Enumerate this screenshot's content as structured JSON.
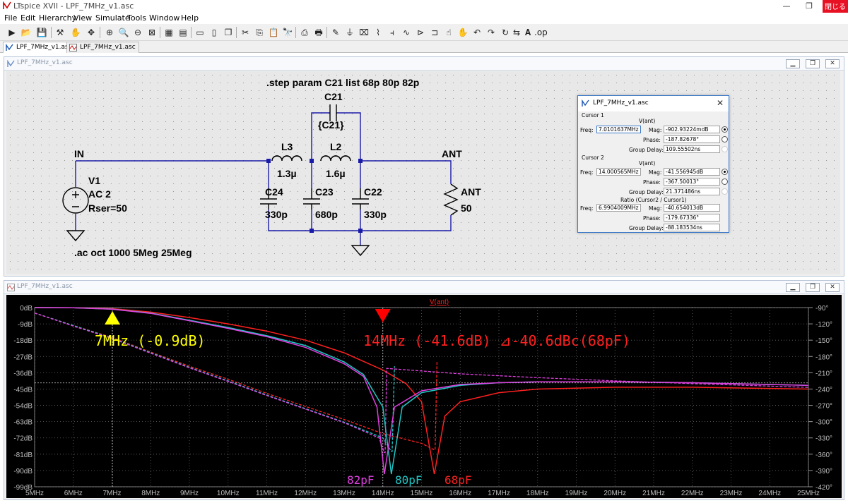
{
  "window": {
    "title": "LTspice XVII - LPF_7MHz_v1.asc",
    "close_label": "閉じる",
    "min_label": "—",
    "max_label": "❐"
  },
  "menu": [
    "File",
    "Edit",
    "Hierarchy",
    "View",
    "Simulate",
    "Tools",
    "Window",
    "Help"
  ],
  "tabs": [
    {
      "label": "LPF_7MHz_v1.asc",
      "active": true
    },
    {
      "label": "LPF_7MHz_v1.asc",
      "active": false
    }
  ],
  "schematic": {
    "window_title": "LPF_7MHz_v1.asc",
    "step_directive": ".step param C21 list 68p 80p 82p",
    "ac_directive": ".ac oct 1000 5Meg 25Meg",
    "net_in": "IN",
    "net_ant": "ANT",
    "v1": {
      "name": "V1",
      "value": "AC 2",
      "rser": "Rser=50"
    },
    "c21": {
      "name": "C21",
      "value": "{C21}"
    },
    "l3": {
      "name": "L3",
      "value": "1.3µ"
    },
    "l2": {
      "name": "L2",
      "value": "1.6µ"
    },
    "c24": {
      "name": "C24",
      "value": "330p"
    },
    "c23": {
      "name": "C23",
      "value": "680p"
    },
    "c22": {
      "name": "C22",
      "value": "330p"
    },
    "rant": {
      "name": "ANT",
      "value": "50"
    }
  },
  "cursor_dialog": {
    "title": "LPF_7MHz_v1.asc",
    "cursor1": {
      "header": "Cursor 1",
      "trace": "V(ant)",
      "freq_label": "Freq:",
      "freq": "7.0101637MHz",
      "mag_label": "Mag:",
      "mag": "-902.93224mdB",
      "phase_label": "Phase:",
      "phase": "-187.82678°",
      "gd_label": "Group Delay:",
      "gd": "109.55502ns"
    },
    "cursor2": {
      "header": "Cursor 2",
      "trace": "V(ant)",
      "freq_label": "Freq:",
      "freq": "14.000565MHz",
      "mag_label": "Mag:",
      "mag": "-41.556945dB",
      "phase_label": "Phase:",
      "phase": "-367.50013°",
      "gd_label": "Group Delay:",
      "gd": "21.371486ns"
    },
    "ratio": {
      "header": "Ratio (Cursor2 / Cursor1)",
      "freq_label": "Freq:",
      "freq": "6.9904009MHz",
      "mag_label": "Mag:",
      "mag": "-40.654013dB",
      "phase_label": "Phase:",
      "phase": "-179.67336°",
      "gd_label": "Group Delay:",
      "gd": "-88.183534ns"
    }
  },
  "waveform": {
    "window_title": "LPF_7MHz_v1.asc"
  },
  "chart_data": {
    "type": "line",
    "title": "V(ant)",
    "x_scale": "linear",
    "xlim": [
      5,
      25
    ],
    "x_ticks": [
      "5MHz",
      "6MHz",
      "7MHz",
      "8MHz",
      "9MHz",
      "10MHz",
      "11MHz",
      "12MHz",
      "13MHz",
      "14MHz",
      "15MHz",
      "16MHz",
      "17MHz",
      "18MHz",
      "19MHz",
      "20MHz",
      "21MHz",
      "22MHz",
      "23MHz",
      "24MHz",
      "25MHz"
    ],
    "y_left_ticks": [
      "0dB",
      "-9dB",
      "-18dB",
      "-27dB",
      "-36dB",
      "-45dB",
      "-54dB",
      "-63dB",
      "-72dB",
      "-81dB",
      "-90dB",
      "-99dB"
    ],
    "ylim_left": [
      -99,
      0
    ],
    "y_right_ticks": [
      "-90°",
      "-120°",
      "-150°",
      "-180°",
      "-210°",
      "-240°",
      "-270°",
      "-300°",
      "-330°",
      "-360°",
      "-390°",
      "-420°"
    ],
    "ylim_right": [
      -420,
      -90
    ],
    "grid": true,
    "cursor1": {
      "x": 7.01,
      "y": -0.9,
      "marker_color": "#ffff00"
    },
    "cursor2": {
      "x": 14.0,
      "y": -41.6,
      "marker_color": "#ff0000"
    },
    "annotations": [
      {
        "text": "7MHz (-0.9dB)",
        "color": "#ffff00"
      },
      {
        "text": "14MHz (-41.6dB) ⊿-40.6dBc(68pF)",
        "color": "#ff2020"
      },
      {
        "text": "82pF",
        "color": "#e040e0"
      },
      {
        "text": "80pF",
        "color": "#20c8c8"
      },
      {
        "text": "68pF",
        "color": "#ff2020"
      }
    ],
    "series": [
      {
        "name": "68pF",
        "color": "#ff2020",
        "notch": 15.33,
        "mag": [
          [
            5,
            0
          ],
          [
            6,
            -0.1
          ],
          [
            7,
            -0.6
          ],
          [
            8,
            -2.5
          ],
          [
            9,
            -5.5
          ],
          [
            10,
            -9
          ],
          [
            11,
            -13
          ],
          [
            12,
            -18
          ],
          [
            13,
            -25
          ],
          [
            14,
            -34.5
          ],
          [
            14.6,
            -42
          ],
          [
            15.0,
            -52
          ],
          [
            15.33,
            -92
          ],
          [
            15.6,
            -60
          ],
          [
            16,
            -52
          ],
          [
            17,
            -47
          ],
          [
            18,
            -45
          ],
          [
            20,
            -44
          ],
          [
            22,
            -44
          ],
          [
            25,
            -45
          ]
        ],
        "phase": [
          [
            5,
            -100
          ],
          [
            6,
            -123
          ],
          [
            7,
            -145
          ],
          [
            8,
            -172
          ],
          [
            9,
            -198
          ],
          [
            10,
            -222
          ],
          [
            11,
            -248
          ],
          [
            12,
            -272
          ],
          [
            13,
            -296
          ],
          [
            14,
            -322
          ],
          [
            15,
            -340
          ],
          [
            15.33,
            -352
          ],
          [
            15.35,
            -352
          ],
          [
            15.4,
            -190
          ]
        ]
      },
      {
        "name": "80pF",
        "color": "#20c8c8",
        "notch": 14.22,
        "mag": [
          [
            5,
            0
          ],
          [
            6,
            -0.1
          ],
          [
            7,
            -0.8
          ],
          [
            8,
            -3
          ],
          [
            9,
            -7
          ],
          [
            10,
            -11
          ],
          [
            11,
            -15.5
          ],
          [
            12,
            -21
          ],
          [
            13,
            -30
          ],
          [
            13.5,
            -37
          ],
          [
            14.0,
            -55
          ],
          [
            14.22,
            -92
          ],
          [
            14.5,
            -55
          ],
          [
            15,
            -47
          ],
          [
            16,
            -43
          ],
          [
            17,
            -41.5
          ],
          [
            18,
            -41
          ],
          [
            20,
            -41
          ],
          [
            22,
            -41.5
          ],
          [
            25,
            -43
          ]
        ],
        "phase": [
          [
            5,
            -100
          ],
          [
            6,
            -123
          ],
          [
            7,
            -146
          ],
          [
            8,
            -173
          ],
          [
            9,
            -200
          ],
          [
            10,
            -225
          ],
          [
            11,
            -251
          ],
          [
            12,
            -276
          ],
          [
            13,
            -301
          ],
          [
            14,
            -330
          ],
          [
            14.22,
            -355
          ],
          [
            14.24,
            -355
          ],
          [
            14.3,
            -198
          ]
        ]
      },
      {
        "name": "82pF",
        "color": "#e040e0",
        "notch": 14.04,
        "mag": [
          [
            5,
            0
          ],
          [
            6,
            -0.1
          ],
          [
            7,
            -0.9
          ],
          [
            8,
            -3.2
          ],
          [
            9,
            -7.3
          ],
          [
            10,
            -11.5
          ],
          [
            11,
            -16
          ],
          [
            12,
            -22
          ],
          [
            13,
            -31
          ],
          [
            13.5,
            -38
          ],
          [
            13.85,
            -55
          ],
          [
            14.04,
            -92
          ],
          [
            14.3,
            -55
          ],
          [
            15,
            -46
          ],
          [
            16,
            -42.5
          ],
          [
            17,
            -41.5
          ],
          [
            18,
            -41
          ],
          [
            20,
            -41
          ],
          [
            22,
            -41.5
          ],
          [
            25,
            -43
          ]
        ],
        "phase": [
          [
            5,
            -100
          ],
          [
            6,
            -124
          ],
          [
            7,
            -147
          ],
          [
            8,
            -174
          ],
          [
            9,
            -201
          ],
          [
            10,
            -226
          ],
          [
            11,
            -252
          ],
          [
            12,
            -277
          ],
          [
            13,
            -302
          ],
          [
            13.9,
            -330
          ],
          [
            14.04,
            -357
          ],
          [
            14.06,
            -357
          ],
          [
            14.1,
            -202
          ],
          [
            16,
            -212
          ],
          [
            18,
            -219
          ],
          [
            20,
            -225
          ],
          [
            22,
            -230
          ],
          [
            25,
            -237
          ]
        ]
      }
    ]
  }
}
